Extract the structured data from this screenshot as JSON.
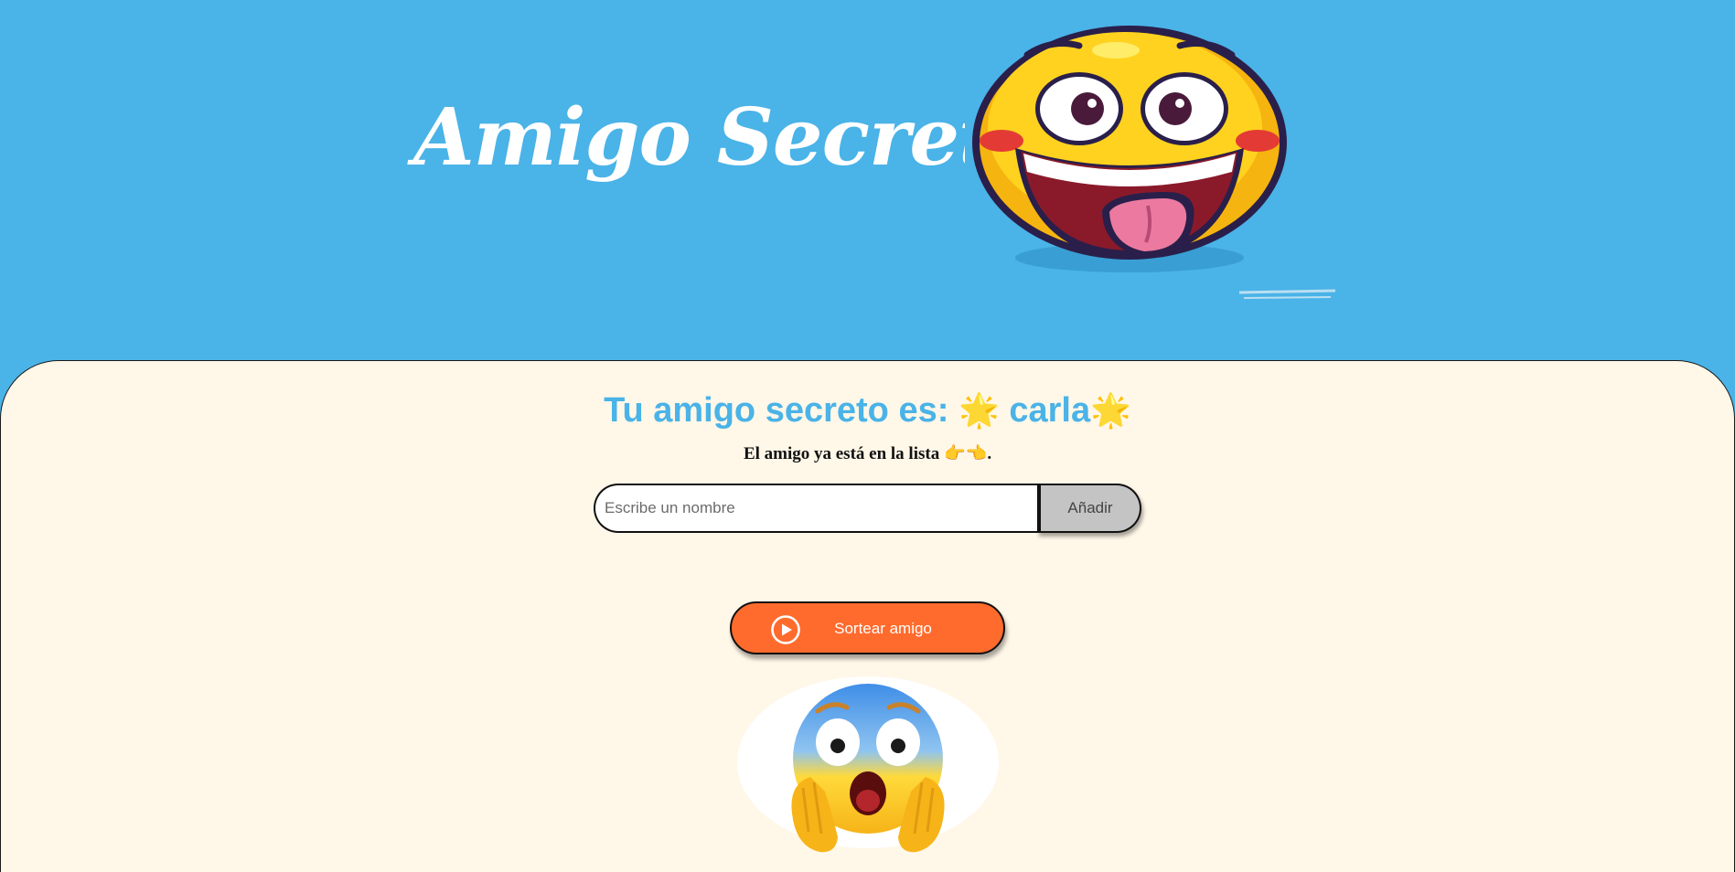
{
  "header": {
    "title": "Amigo Secreto",
    "logo_icon": "laughing-tongue-emoji"
  },
  "result": {
    "prefix": "Tu amigo secreto es:",
    "sparkle_left": "🌟",
    "name": "carla",
    "sparkle_right": "🌟"
  },
  "message": {
    "text": "El amigo ya está en la lista",
    "pointer_right": "👉",
    "pointer_left": "👈",
    "end": "."
  },
  "form": {
    "input_value": "",
    "input_placeholder": "Escribe un nombre",
    "add_label": "Añadir"
  },
  "draw": {
    "label": "Sortear amigo",
    "icon": "play-circle-icon"
  },
  "footer_image": {
    "icon": "screaming-face-emoji"
  },
  "colors": {
    "header_bg": "#4ab3e7",
    "main_bg": "#fff7e8",
    "accent_text": "#4ab3e7",
    "draw_button": "#ff6b2d",
    "add_button": "#c4c4c4"
  }
}
